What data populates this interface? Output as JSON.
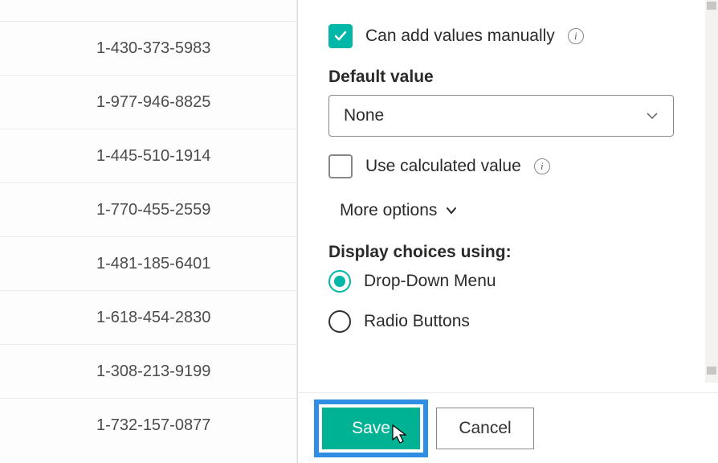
{
  "list": {
    "rows": [
      "",
      "1-430-373-5983",
      "1-977-946-8825",
      "1-445-510-1914",
      "1-770-455-2559",
      "1-481-185-6401",
      "1-618-454-2830",
      "1-308-213-9199",
      "1-732-157-0877"
    ]
  },
  "panel": {
    "can_add_label": "Can add values manually",
    "can_add_checked": true,
    "default_value_label": "Default value",
    "default_value_selected": "None",
    "use_calculated_label": "Use calculated value",
    "use_calculated_checked": false,
    "more_options_label": "More options",
    "display_choices_label": "Display choices using:",
    "radios": [
      {
        "label": "Drop-Down Menu",
        "selected": true
      },
      {
        "label": "Radio Buttons",
        "selected": false
      }
    ],
    "save_label": "Save",
    "cancel_label": "Cancel"
  }
}
